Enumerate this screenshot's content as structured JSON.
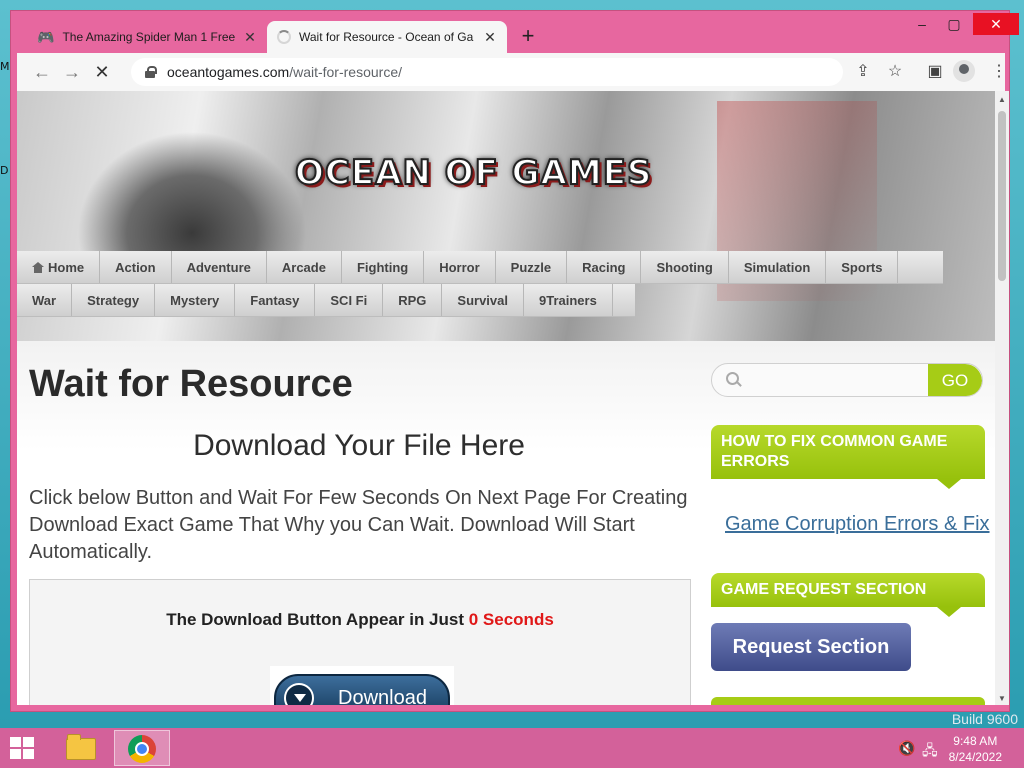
{
  "browser": {
    "tabs": [
      {
        "title": "The Amazing Spider Man 1 Free",
        "icon": "gamepad-icon"
      },
      {
        "title": "Wait for Resource - Ocean of Ga",
        "icon": "loading-icon"
      }
    ],
    "url_host": "oceantogames.com",
    "url_path": "/wait-for-resource/",
    "newtab": "+",
    "min": "–",
    "max": "▢",
    "close": "✕",
    "back": "←",
    "forward": "→",
    "reload": "✕",
    "share": "⇪",
    "star": "☆",
    "sidepanel": "▣",
    "menu": "⋮"
  },
  "site": {
    "logo": "OCEAN OF GAMES",
    "nav_row1": [
      "Home",
      "Action",
      "Adventure",
      "Arcade",
      "Fighting",
      "Horror",
      "Puzzle",
      "Racing",
      "Shooting",
      "Simulation",
      "Sports"
    ],
    "nav_row2": [
      "War",
      "Strategy",
      "Mystery",
      "Fantasy",
      "SCI Fi",
      "RPG",
      "Survival",
      "9Trainers"
    ]
  },
  "main": {
    "title": "Wait for Resource",
    "subhead": "Download Your File Here",
    "body": "Click below Button and Wait For Few Seconds On Next Page For Creating Download Exact Game That Why you Can Wait. Download Will Start Automatically.",
    "download_msg": "The Download Button Appear in Just",
    "download_count": "0 Seconds",
    "download_label": "Download"
  },
  "sidebar": {
    "search_placeholder": "",
    "go_label": "GO",
    "heading1": "HOW TO FIX COMMON GAME ERRORS",
    "link1": "Game Corruption Errors & Fix",
    "heading2": "GAME REQUEST SECTION",
    "request_label": "Request Section"
  },
  "desktop": {
    "build": "Build 9600",
    "edge1": "M",
    "edge2": "D"
  },
  "taskbar": {
    "time": "9:48 AM",
    "date": "8/24/2022",
    "volume": "🔇",
    "network": "🖧"
  },
  "colors": {
    "window_frame": "#e7679f",
    "accent_green": "#a6cc16",
    "link_blue": "#3a6e9a",
    "countdown_red": "#e01818"
  }
}
